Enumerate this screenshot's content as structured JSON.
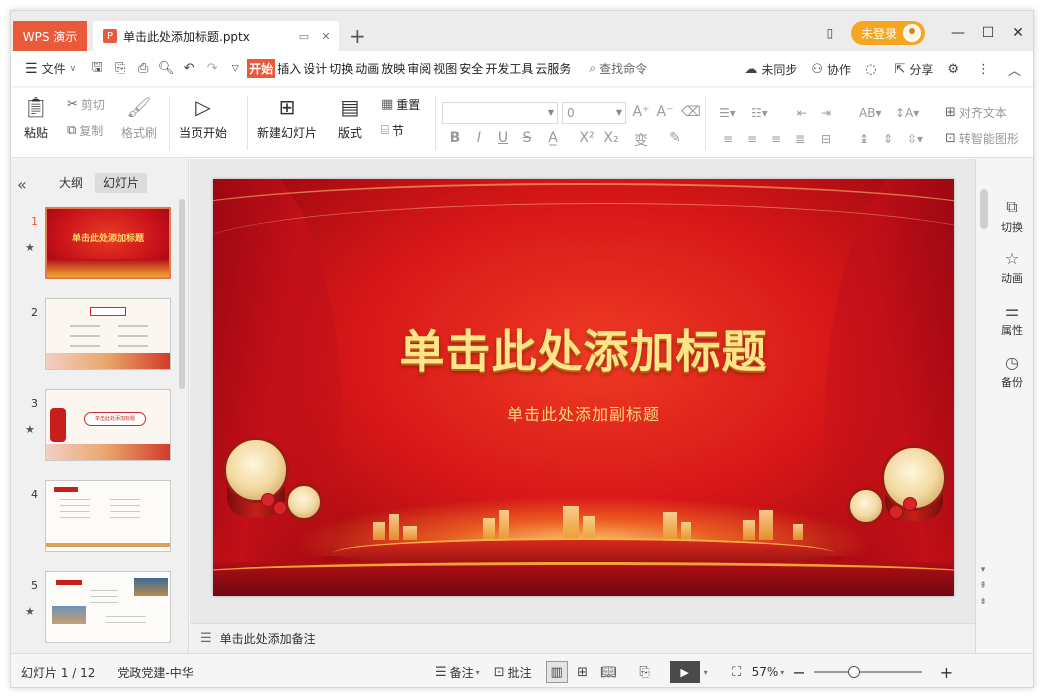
{
  "titlebar": {
    "app_tab": "WPS 演示",
    "doc_icon": "P",
    "doc_title": "单击此处添加标题.pptx",
    "new_tab": "+",
    "login_label": "未登录"
  },
  "menubar": {
    "file_label": "文件",
    "tabs": [
      "开始",
      "插入",
      "设计",
      "切换",
      "动画",
      "放映",
      "审阅",
      "视图",
      "安全",
      "开发工具",
      "云服务"
    ],
    "active_tab": "开始",
    "search_label": "查找命令",
    "sync_label": "未同步",
    "collab_label": "协作",
    "share_label": "分享"
  },
  "ribbon": {
    "paste": "粘贴",
    "cut": "剪切",
    "copy": "复制",
    "format_painter": "格式刷",
    "play_from_current": "当页开始",
    "new_slide": "新建幻灯片",
    "layout": "版式",
    "reset": "重置",
    "section": "节",
    "font_name": "",
    "font_size": "0",
    "align_text": "对齐文本",
    "smart_graphic": "转智能图形"
  },
  "left_panel": {
    "tab_outline": "大纲",
    "tab_slides": "幻灯片",
    "active_tab": "幻灯片",
    "thumbnails": [
      {
        "num": "1",
        "star": true,
        "selected": true
      },
      {
        "num": "2",
        "star": false,
        "selected": false
      },
      {
        "num": "3",
        "star": true,
        "selected": false
      },
      {
        "num": "4",
        "star": false,
        "selected": false
      },
      {
        "num": "5",
        "star": true,
        "selected": false
      }
    ],
    "thumb1_title": "单击此处添加标题",
    "thumb3_title": "单击此处添加标题"
  },
  "slide": {
    "title": "单击此处添加标题",
    "subtitle": "单击此处添加副标题"
  },
  "notes": {
    "placeholder": "单击此处添加备注"
  },
  "right_pane": {
    "items": [
      "切换",
      "动画",
      "属性",
      "备份"
    ]
  },
  "statusbar": {
    "slide_info": "幻灯片 1 / 12",
    "theme": "党政党建-中华",
    "notes_btn": "备注",
    "comment_btn": "批注",
    "zoom": "57%",
    "zoom_level": 0.57
  },
  "colors": {
    "accent": "#e9593a",
    "login": "#f5a623",
    "slide_red": "#d71718",
    "title_gold": "#ffe58a"
  }
}
